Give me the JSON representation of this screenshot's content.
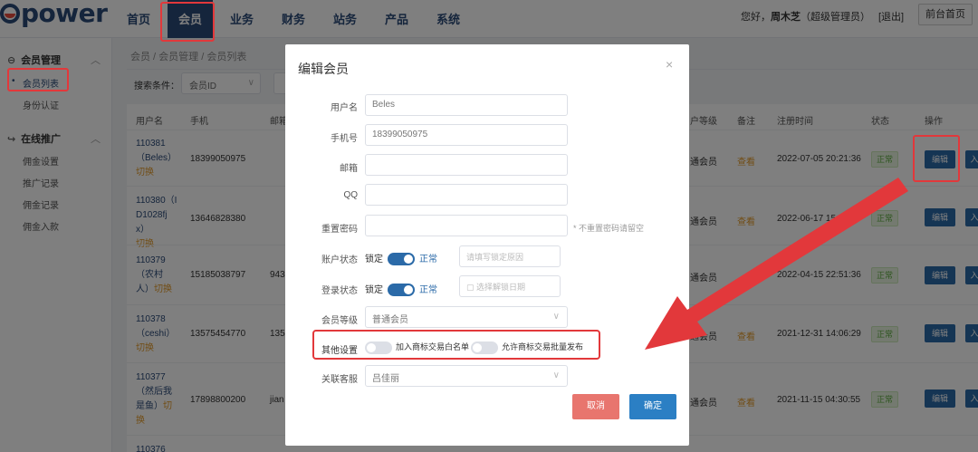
{
  "brand": {
    "logo_text": "power"
  },
  "nav": [
    "首页",
    "会员",
    "业务",
    "财务",
    "站务",
    "产品",
    "系统"
  ],
  "header": {
    "greeting_prefix": "您好，",
    "user_name": "周木芝",
    "role": "（超级管理员）",
    "logout": "[退出]",
    "front_page": "前台首页"
  },
  "sidebar": {
    "groups": [
      {
        "label": "会员管理",
        "items": [
          "会员列表",
          "身份认证"
        ]
      },
      {
        "label": "在线推广",
        "items": [
          "佣金设置",
          "推广记录",
          "佣金记录",
          "佣金入款"
        ]
      }
    ]
  },
  "breadcrumb": "会员 / 会员管理 / 会员列表",
  "search": {
    "label": "搜索条件：",
    "field": "会员ID"
  },
  "table": {
    "headers": [
      "用户名",
      "手机",
      "邮箱",
      "户等级",
      "备注",
      "注册时间",
      "状态",
      "操作"
    ],
    "rows": [
      {
        "user_line1": "110381",
        "user_line2": "（Beles）",
        "switch": "切换",
        "phone": "18399050975",
        "email": "",
        "level": "通会员",
        "remark": "查看",
        "time": "2022-07-05 20:21:36",
        "status": "正常",
        "edit": "编辑"
      },
      {
        "user_line1": "110380（I",
        "user_line2": "D1028fj",
        "user_line3": "x）",
        "switch": "切换",
        "phone": "13646828380",
        "email": "",
        "level": "通会员",
        "remark": "查看",
        "time": "2022-06-17 15:",
        "status": "正常",
        "edit": "编辑"
      },
      {
        "user_line1": "110379",
        "user_line2": "（农村",
        "user_line3": "人）",
        "switch": "切换",
        "phone": "15185038797",
        "email": "943",
        "level": "通会员",
        "remark": "",
        "time": "2022-04-15 22:51:36",
        "status": "正常",
        "edit": "编辑"
      },
      {
        "user_line1": "110378",
        "user_line2": "（ceshi）",
        "switch": "切换",
        "phone": "13575454770",
        "email": "135",
        "level": "通会员",
        "remark": "查看",
        "time": "2021-12-31 14:06:29",
        "status": "正常",
        "edit": "编辑"
      },
      {
        "user_line1": "110377",
        "user_line2": "（然后我",
        "user_line3": "是鱼）",
        "switch": "切",
        "switch2": "换",
        "phone": "17898800200",
        "email": "jian",
        "level": "通会员",
        "remark": "查看",
        "time": "2021-11-15 04:30:55",
        "status": "正常",
        "edit": "编辑"
      },
      {
        "user_line1": "110376"
      }
    ],
    "edge_label": "入"
  },
  "modal": {
    "title": "编辑会员",
    "close": "×",
    "fields": {
      "username": {
        "label": "用户名",
        "value": "Beles"
      },
      "phone": {
        "label": "手机号",
        "value": "18399050975"
      },
      "email": {
        "label": "邮箱",
        "value": ""
      },
      "qq": {
        "label": "QQ",
        "value": ""
      },
      "password": {
        "label": "重置密码",
        "value": "",
        "hint": "* 不重置密码请留空"
      },
      "account_status": {
        "label": "账户状态",
        "off_text": "锁定",
        "on_text": "正常",
        "reason_placeholder": "请填写锁定原因"
      },
      "login_status": {
        "label": "登录状态",
        "off_text": "锁定",
        "on_text": "正常",
        "date_placeholder": "选择解锁日期"
      },
      "level": {
        "label": "会员等级",
        "value": "普通会员"
      },
      "other": {
        "label": "其他设置",
        "option1": "加入商标交易白名单",
        "option2": "允许商标交易批量发布"
      },
      "service": {
        "label": "关联客服",
        "value": "吕佳丽"
      }
    },
    "cancel": "取消",
    "confirm": "确定"
  },
  "colors": {
    "brand": "#2b4a78",
    "highlight": "#e2383b",
    "primary": "#2b6aa8",
    "cancel": "#e8756e"
  }
}
